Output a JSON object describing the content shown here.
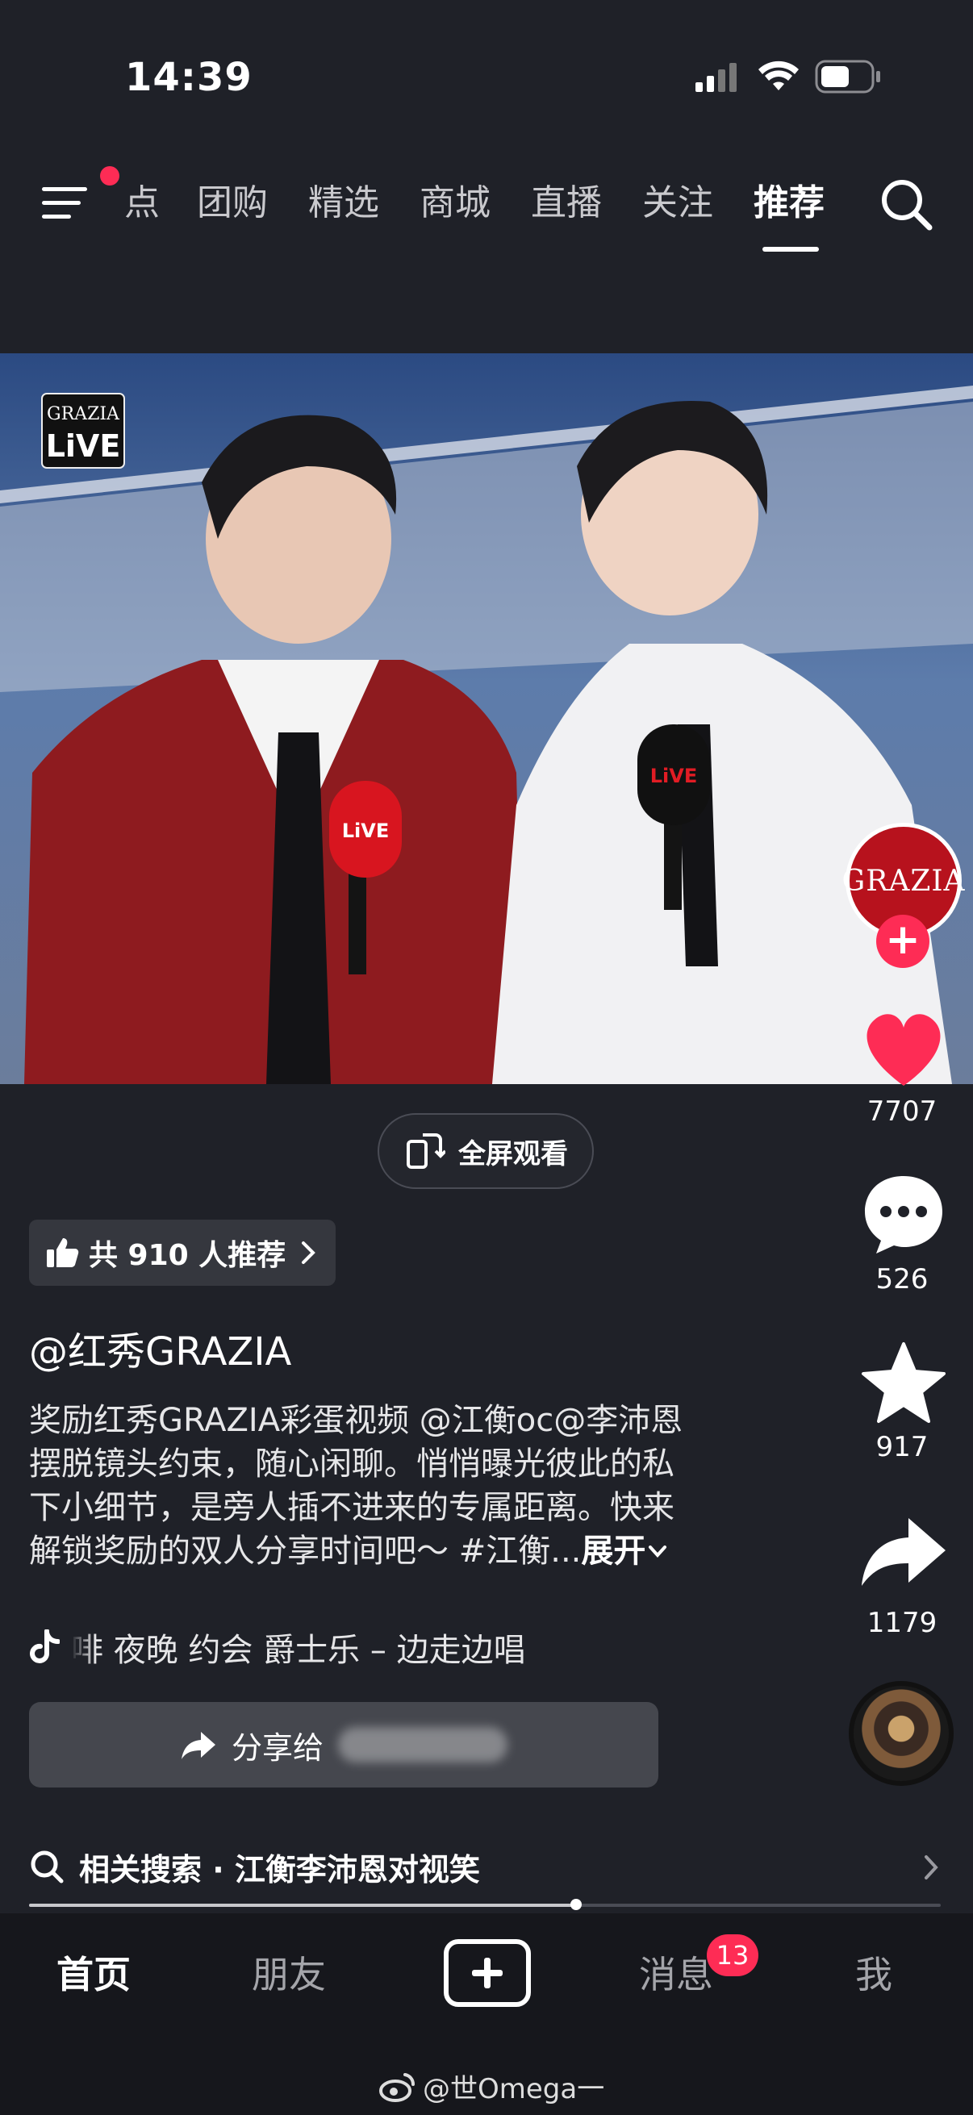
{
  "status_bar": {
    "time": "14:39",
    "icons": [
      "signal-icon",
      "wifi-icon",
      "battery-icon"
    ]
  },
  "top_nav": {
    "menu_icon": "menu-icon",
    "has_notification_dot": true,
    "tabs": [
      {
        "label": "点",
        "active": false
      },
      {
        "label": "团购",
        "active": false
      },
      {
        "label": "精选",
        "active": false
      },
      {
        "label": "商城",
        "active": false
      },
      {
        "label": "直播",
        "active": false
      },
      {
        "label": "关注",
        "active": false
      },
      {
        "label": "推荐",
        "active": true
      }
    ],
    "search_icon": "search-icon"
  },
  "video": {
    "overlay_logo_top": "GRAZIA",
    "overlay_logo_bottom": "LiVE",
    "mic_text": "LiVE"
  },
  "actions": {
    "author_avatar_text": "GRAZIA",
    "follow_icon": "plus-icon",
    "likes": "7707",
    "comments": "526",
    "favorites": "917",
    "shares": "1179"
  },
  "fullscreen": {
    "label": "全屏观看"
  },
  "recommend": {
    "label": "共 910 人推荐"
  },
  "post": {
    "author": "@红秀GRAZIA",
    "caption_lines": [
      "奖励红秀GRAZIA彩蛋视频 @江衡oc@李沛恩",
      "摆脱镜头约束，随心闲聊。悄悄曝光彼此的私",
      "下小细节，是旁人插不进来的专属距离。快来",
      "解锁奖励的双人分享时间吧～ #江衡..."
    ],
    "expand_label": "展开"
  },
  "music": {
    "title": "啡 夜晚 约会 爵士乐 – 边走边唱"
  },
  "share": {
    "label": "分享给"
  },
  "related": {
    "label": "相关搜索 · 江衡李沛恩对视笑"
  },
  "progress": {
    "fraction": 0.6
  },
  "bottom_tabs": {
    "home": "首页",
    "friends": "朋友",
    "messages": "消息",
    "messages_badge": "13",
    "me": "我"
  },
  "watermark": {
    "text": "@世Omega一"
  },
  "colors": {
    "accent": "#fe2c55",
    "background": "#1f2128",
    "tabbar": "#16171c"
  }
}
